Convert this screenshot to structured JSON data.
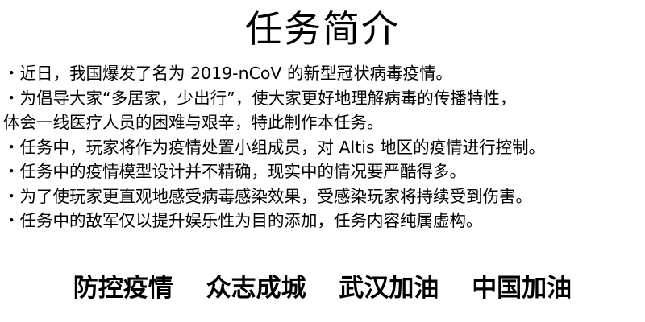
{
  "title": "任务简介",
  "lines": [
    "・近日，我国爆发了名为 2019-nCoV 的新型冠状病毒疫情。",
    "・为倡导大家“多居家，少出行”，使大家更好地理解病毒的传播特性，",
    "体会一线医疗人员的困难与艰辛，特此制作本任务。",
    "・任务中，玩家将作为疫情处置小组成员，对 Altis 地区的疫情进行控制。",
    "・任务中的疫情模型设计并不精确，现实中的情况要严酷得多。",
    "・为了使玩家更直观地感受病毒感染效果，受感染玩家将持续受到伤害。",
    "・任务中的敌军仅以提升娱乐性为目的添加，任务内容纯属虚构。"
  ],
  "slogans": [
    "防控疫情",
    "众志成城",
    "武汉加油",
    "中国加油"
  ]
}
